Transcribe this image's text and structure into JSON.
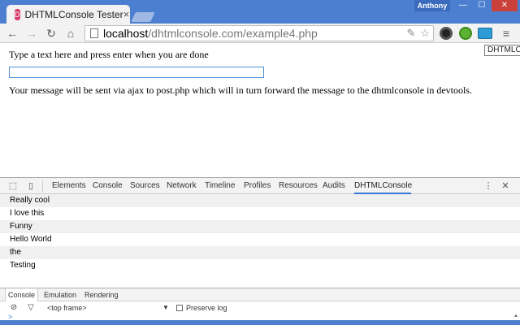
{
  "window": {
    "user_name": "Anthony",
    "buttons": {
      "minimize": "—",
      "maximize": "☐",
      "close": "✕"
    }
  },
  "tab": {
    "favicon_text": "D",
    "title": "DHTMLConsole Tester",
    "close": "×"
  },
  "toolbar": {
    "back": "←",
    "forward": "→",
    "reload": "↻",
    "home": "⌂",
    "url_host": "localhost",
    "url_path": "/dhtmlconsole.com/example4.php",
    "menu": "≡",
    "tooltip": "DHTMLC"
  },
  "page": {
    "prompt": "Type a text here and press enter when you are done",
    "input_value": "",
    "note": "Your message will be sent via ajax to post.php which will in turn forward the message to the dhtmlconsole in devtools."
  },
  "devtools": {
    "tabs": [
      "Elements",
      "Console",
      "Sources",
      "Network",
      "Timeline",
      "Profiles",
      "Resources",
      "Audits",
      "DHTMLConsole"
    ],
    "active_tab": "DHTMLConsole",
    "messages": [
      "Really cool",
      "I love this",
      "Funny",
      "Hello World",
      "the",
      "Testing"
    ],
    "drawer_tabs": [
      "Console",
      "Emulation",
      "Rendering"
    ],
    "frame": "<top frame>",
    "preserve_log": "Preserve log",
    "prompt_symbol": ">"
  },
  "colors": {
    "chrome_frame": "#4f80d0",
    "active_tab_underline": "#3879d9",
    "input_border": "#4d8fd6"
  }
}
